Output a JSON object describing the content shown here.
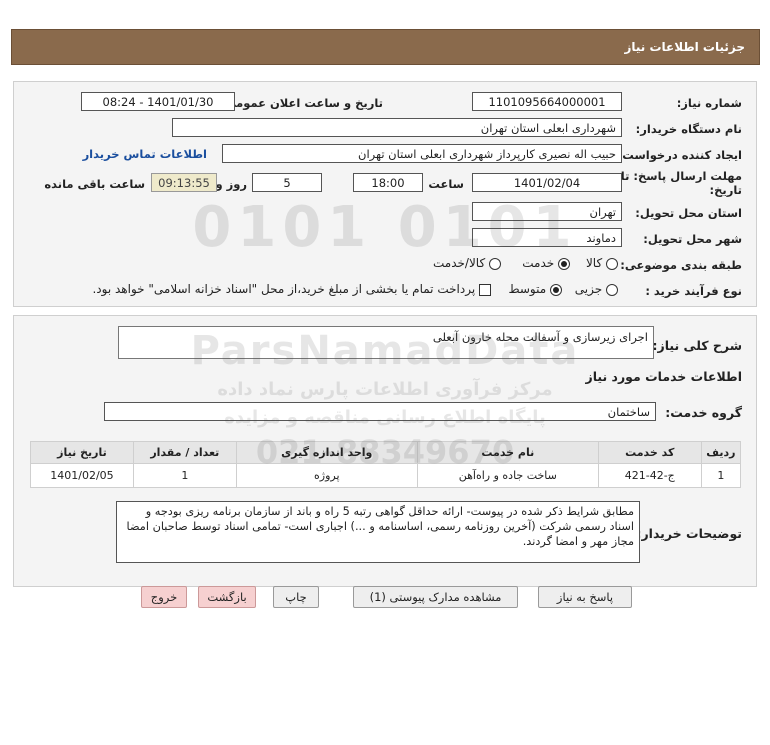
{
  "header": {
    "title": "جزئیات اطلاعات نیاز"
  },
  "form": {
    "need_number_label": "شماره نیاز:",
    "need_number": "1101095664000001",
    "announce_label": "تاریخ و ساعت اعلان عمومی:",
    "announce_value": "1401/01/30 - 08:24",
    "buyer_org_label": "نام دستگاه خریدار:",
    "buyer_org": "شهرداری ابعلی استان تهران",
    "creator_label": "ایجاد کننده درخواست:",
    "creator": "حبیب اله نصیری کارپرداز شهرداری ابعلی استان تهران",
    "contact_link": "اطلاعات تماس خریدار",
    "deadline_label_1": "مهلت ارسال پاسخ: تا",
    "deadline_label_2": "تاریخ:",
    "deadline_date": "1401/02/04",
    "time_label": "ساعت",
    "deadline_time": "18:00",
    "days": "5",
    "days_label": "روز و",
    "remaining_time": "09:13:55",
    "remaining_label": "ساعت باقی مانده",
    "province_label": "استان محل تحویل:",
    "province": "تهران",
    "city_label": "شهر محل تحویل:",
    "city": "دماوند",
    "category_label": "طبقه بندی موضوعی:",
    "category_options": [
      "کالا",
      "خدمت",
      "کالا/خدمت"
    ],
    "purchase_type_label": "نوع فرآیند خرید :",
    "purchase_options": [
      "جزیی",
      "متوسط"
    ],
    "payment_note": "پرداخت تمام یا بخشی از مبلغ خرید،از محل \"اسناد خزانه اسلامی\" خواهد بود."
  },
  "details": {
    "summary_label": "شرح کلی نیاز:",
    "summary": "اجرای زیرسازی و آسفالت محله خارون آبعلی",
    "services_heading": "اطلاعات خدمات مورد نیاز",
    "service_group_label": "گروه خدمت:",
    "service_group": "ساختمان",
    "table_headers": [
      "ردیف",
      "کد خدمت",
      "نام خدمت",
      "واحد اندازه گیری",
      "تعداد / مقدار",
      "تاریخ نیاز"
    ],
    "rows": [
      [
        "1",
        "ج-42-421",
        "ساخت جاده و راه‌آهن",
        "پروژه",
        "1",
        "1401/02/05"
      ]
    ],
    "buyer_notes_label": "توضیحات خریدار:",
    "buyer_notes": "مطابق شرایط ذکر شده در پیوست- ارائه حداقل گواهی رتبه 5 راه و باند از سازمان برنامه ریزی بودجه و اسناد رسمی شرکت (آخرین روزنامه رسمی، اساسنامه و ...) اجباری است- تمامی اسناد توسط صاحبان امضا مجاز مهر و امضا گردند."
  },
  "buttons": {
    "reply": "پاسخ به نیاز",
    "view_docs": "مشاهده مدارک پیوستی (1)",
    "print": "چاپ",
    "back": "بازگشت",
    "exit": "خروج"
  },
  "watermark": {
    "digits": "0101 0101",
    "brand": "ParsNamadData",
    "line1": "مرکز فرآوری اطلاعات پارس نماد داده",
    "line2": "پایگاه اطلاع رسانی مناقصه و مزایده",
    "phone": "021-88349670"
  }
}
